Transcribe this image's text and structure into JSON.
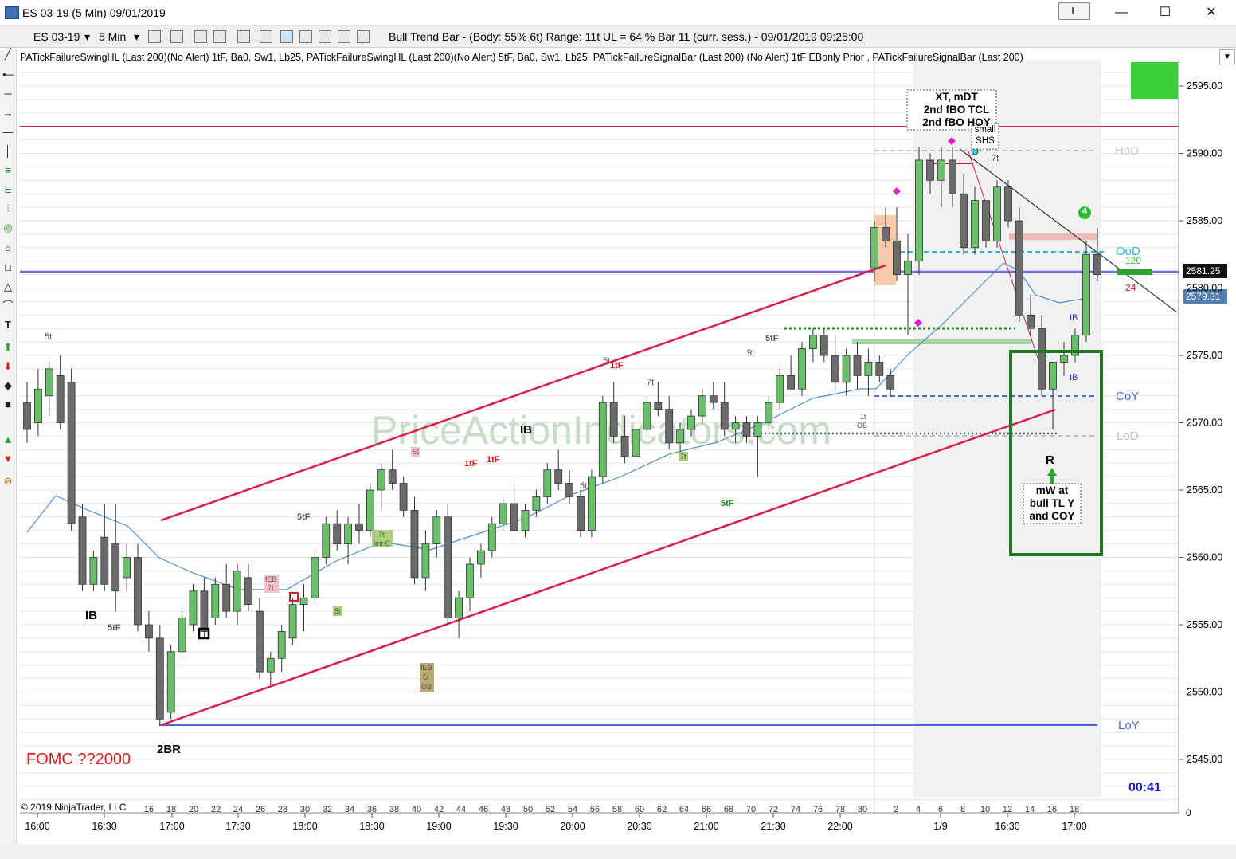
{
  "window": {
    "title": "ES 03-19 (5 Min)  09/01/2019",
    "layout_button": "L",
    "minimize_glyph": "—",
    "maximize_glyph": "☐",
    "close_glyph": "✕",
    "icon": "chart-app-icon"
  },
  "toolbar": {
    "instrument": "ES 03-19",
    "interval": "5 Min",
    "bar_info": "Bull Trend Bar - (Body: 55%  6t)    Range: 11t     UL = 64 %   Bar 11 (curr. sess.) - 09/01/2019 09:25:00",
    "icons": [
      "bar-type-icon",
      "draw-pencil-icon",
      "magnet-icon",
      "crosshair-icon",
      "zoom-icon",
      "data-box-icon",
      "indicators-icon",
      "strategies-icon",
      "properties-icon"
    ]
  },
  "indicator_header": "PATickFailureSwingHL (Last 200)(No Alert) 1tF,  Ba0,  Sw1,  Lb25, PATickFailureSwingHL (Last 200)(No Alert) 5tF,  Ba0,  Sw1,  Lb25, PATickFailureSignalBar (Last 200) (No Alert)   1tF  EBonly  Prior  , PATickFailureSignalBar (Last 200)",
  "sidebar_icons": [
    "line-icon",
    "ray-icon",
    "extended-line-icon",
    "arrow-line-icon",
    "horizontal-line-icon",
    "vertical-line-icon",
    "fib-retracement-icon",
    "fib-extension-icon",
    "regression-channel-icon",
    "fib-circle-icon",
    "ellipse-icon",
    "rectangle-icon",
    "triangle-icon",
    "arc-icon",
    "text-icon",
    "arrow-up-icon",
    "arrow-down-icon",
    "diamond-icon",
    "square-icon",
    "triangle-up-icon",
    "triangle-down-icon",
    "ruler-icon"
  ],
  "price_axis": {
    "ticks": [
      "2595.00",
      "2590.00",
      "2585.00",
      "2580.00",
      "2575.00",
      "2570.00",
      "2565.00",
      "2560.00",
      "2555.00",
      "2550.00",
      "2545.00"
    ],
    "last_price": "2581.25",
    "ema_price": "2579.31",
    "zero_label": "0"
  },
  "time_axis": {
    "labels": [
      "16:00",
      "16:30",
      "17:00",
      "17:30",
      "18:00",
      "18:30",
      "19:00",
      "19:30",
      "20:00",
      "20:30",
      "21:00",
      "21:30",
      "22:00",
      "1/9",
      "16:30",
      "17:00"
    ],
    "bar_numbers": [
      "16",
      "18",
      "20",
      "22",
      "24",
      "26",
      "28",
      "30",
      "32",
      "34",
      "36",
      "38",
      "40",
      "42",
      "44",
      "46",
      "48",
      "50",
      "52",
      "54",
      "56",
      "58",
      "60",
      "62",
      "64",
      "66",
      "68",
      "70",
      "72",
      "74",
      "76",
      "78",
      "80",
      "2",
      "4",
      "6",
      "8",
      "10",
      "12",
      "14",
      "16",
      "18"
    ]
  },
  "levels": {
    "hod": "HoD",
    "ood": "OoD",
    "coy": "CoY",
    "lod": "LoD",
    "loy": "LoY"
  },
  "annotations": {
    "note_top": [
      "XT, mDT",
      "2nd fBO TCL",
      "2nd fBO HOY"
    ],
    "small_shs": [
      "small",
      "SHS"
    ],
    "signal_label": "R",
    "setup_note": [
      "mW at",
      "bull TL Y",
      "and COY"
    ],
    "fomc": "FOMC ??2000",
    "ib_left": "IB",
    "ib_mid": "IB",
    "ib_small_1": "IB",
    "ib_small_2": "IB",
    "two_br": "2BR",
    "counter_circle": "4",
    "count_120": "120",
    "count_24": "24",
    "timer": "00:41",
    "copyright": "© 2019 NinjaTrader, LLC",
    "watermark": "PriceActionIndicators.com",
    "tags": {
      "t5_top": "5t",
      "tf5_left": "5tF",
      "tf5_a": "5tF",
      "t5_mid": "5t",
      "tf1_a": "1tF",
      "tf1_b": "1tF",
      "tf1_c": "1tF",
      "t7_a": "7t",
      "t5_b": "5t",
      "t9": "9t",
      "tf5_b": "5tF",
      "tf5_c": "5tF",
      "t7_b": "7t",
      "t1_ob_a": "1t",
      "t1_ob_b": "OB",
      "t7_top": "7t",
      "feb_a": "fEB",
      "feb_a2": "7t",
      "feb_b": "fEB",
      "feb_b2": "5t",
      "feb_b3": "OB",
      "imt_a": "7t",
      "imt_b": "lmt C",
      "box5t": "5t",
      "box7t": "7t",
      "pink5t": "5t"
    }
  },
  "colors": {
    "bull_bar": "#6abf6a",
    "bear_bar": "#6b6b6b",
    "channel": "#d6204a",
    "ema": "#4f8fd0",
    "level_blue": "#4a6bd6",
    "hod_gray": "#b0b0b0",
    "ood_cyan": "#2fb5e0",
    "setup_box": "#1e7a1e"
  }
}
